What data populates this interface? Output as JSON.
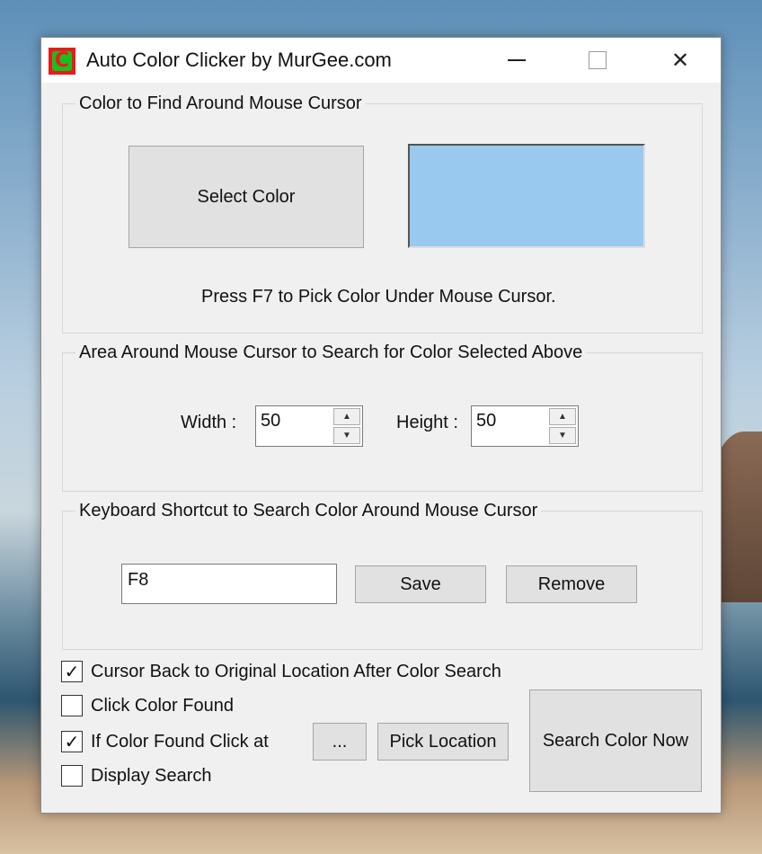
{
  "window": {
    "title": "Auto Color Clicker by MurGee.com",
    "icon_letter": "C",
    "minimize_glyph": "",
    "close_glyph": "✕"
  },
  "color_group": {
    "legend": "Color to Find Around Mouse Cursor",
    "select_button": "Select Color",
    "swatch_color": "#99c9ee",
    "hint": "Press F7 to Pick Color Under Mouse Cursor."
  },
  "area_group": {
    "legend": "Area Around Mouse Cursor to Search for Color Selected Above",
    "width_label": "Width :",
    "width_value": "50",
    "height_label": "Height :",
    "height_value": "50",
    "up_arrow": "▲",
    "down_arrow": "▼"
  },
  "shortcut_group": {
    "legend": "Keyboard Shortcut to Search Color Around Mouse Cursor",
    "shortcut_value": "F8",
    "save_button": "Save",
    "remove_button": "Remove"
  },
  "options": [
    {
      "label": "Cursor Back to Original Location After Color Search",
      "checked": true
    },
    {
      "label": "Click Color Found",
      "checked": false
    },
    {
      "label": "If Color Found Click at",
      "checked": true
    },
    {
      "label": "Display Search",
      "checked": false
    }
  ],
  "check_glyph": "✓",
  "browse_button": "...",
  "pick_location_button": "Pick Location",
  "search_now_button": "Search Color Now"
}
